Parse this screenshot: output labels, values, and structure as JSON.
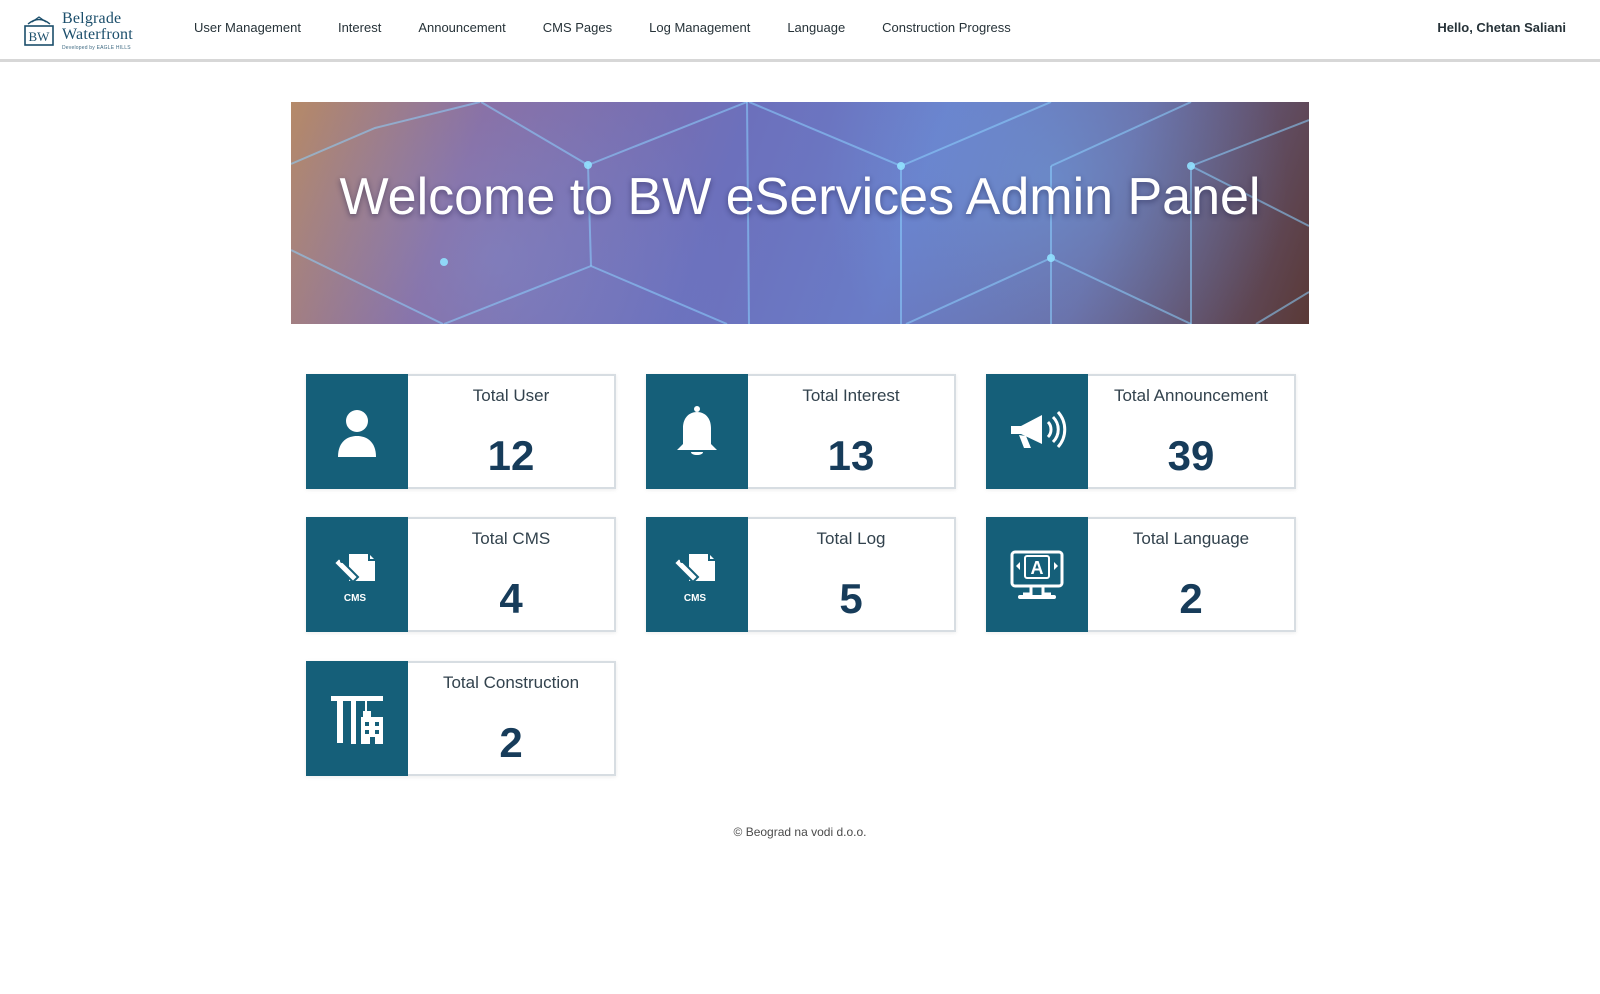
{
  "brand": {
    "line1": "Belgrade",
    "line2": "Waterfront",
    "tagline": "Developed by EAGLE HILLS",
    "logo_mark": "BW",
    "primary_color": "#155f79",
    "dark_text_color": "#173c5a"
  },
  "nav": {
    "items": [
      {
        "label": "User Management"
      },
      {
        "label": "Interest"
      },
      {
        "label": "Announcement"
      },
      {
        "label": "CMS Pages"
      },
      {
        "label": "Log Management"
      },
      {
        "label": "Language"
      },
      {
        "label": "Construction Progress"
      }
    ],
    "greeting": "Hello, Chetan Saliani"
  },
  "hero": {
    "title": "Welcome to BW eServices Admin Panel"
  },
  "stats": [
    {
      "title": "Total User",
      "value": "12",
      "icon": "user-icon"
    },
    {
      "title": "Total Interest",
      "value": "13",
      "icon": "bell-icon"
    },
    {
      "title": "Total Announcement",
      "value": "39",
      "icon": "megaphone-icon"
    },
    {
      "title": "Total CMS",
      "value": "4",
      "icon": "cms-icon",
      "icon_text": "CMS"
    },
    {
      "title": "Total Log",
      "value": "5",
      "icon": "cms-icon",
      "icon_text": "CMS"
    },
    {
      "title": "Total Language",
      "value": "2",
      "icon": "language-monitor-icon",
      "icon_text": "A"
    },
    {
      "title": "Total Construction",
      "value": "2",
      "icon": "construction-icon"
    }
  ],
  "footer": {
    "text": "© Beograd na vodi d.o.o."
  }
}
